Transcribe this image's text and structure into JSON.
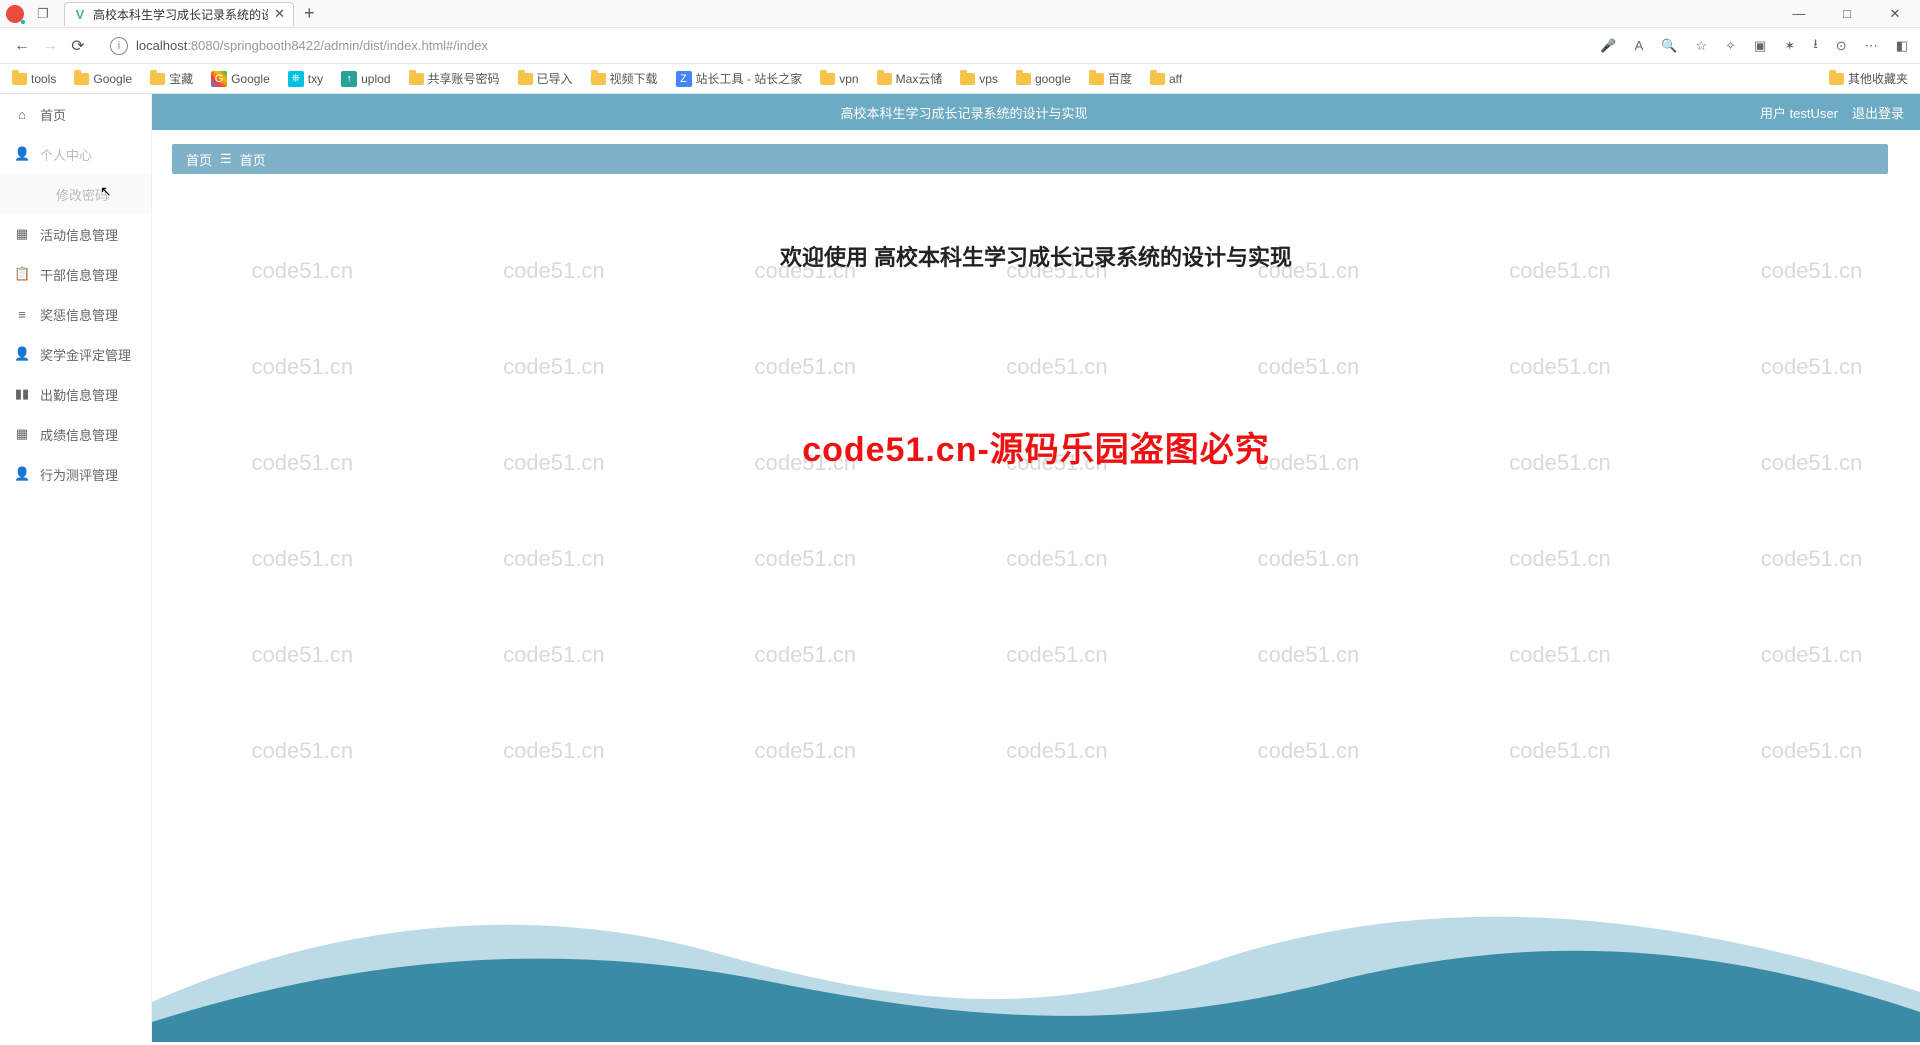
{
  "browser": {
    "tab_title": "高校本科生学习成长记录系统的设…",
    "url_host": "localhost",
    "url_port": ":8080",
    "url_path": "/springbooth8422/admin/dist/index.html#/index",
    "new_tab_plus": "+",
    "win_min": "—",
    "win_max": "□",
    "win_close": "✕",
    "back": "←",
    "fwd": "→",
    "reload": "⟳"
  },
  "bookmarks": [
    {
      "label": "tools",
      "kind": "folder"
    },
    {
      "label": "Google",
      "kind": "folder"
    },
    {
      "label": "宝藏",
      "kind": "folder"
    },
    {
      "label": "Google",
      "kind": "multi"
    },
    {
      "label": "txy",
      "kind": "cyan"
    },
    {
      "label": "uplod",
      "kind": "teal"
    },
    {
      "label": "共享账号密码",
      "kind": "folder"
    },
    {
      "label": "已导入",
      "kind": "folder"
    },
    {
      "label": "视频下载",
      "kind": "folder"
    },
    {
      "label": "站长工具 - 站长之家",
      "kind": "blue"
    },
    {
      "label": "vpn",
      "kind": "folder"
    },
    {
      "label": "Max云储",
      "kind": "folder"
    },
    {
      "label": "vps",
      "kind": "folder"
    },
    {
      "label": "google",
      "kind": "folder"
    },
    {
      "label": "百度",
      "kind": "folder"
    },
    {
      "label": "aff",
      "kind": "folder"
    }
  ],
  "bookmarks_right": "其他收藏夹",
  "sidebar": {
    "items": [
      {
        "icon": "⌂",
        "label": "首页"
      },
      {
        "icon": "👤",
        "label": "个人中心",
        "expanded": true
      },
      {
        "icon": "",
        "label": "修改密码",
        "sub": true,
        "hover": true
      },
      {
        "icon": "▦",
        "label": "活动信息管理"
      },
      {
        "icon": "📋",
        "label": "干部信息管理"
      },
      {
        "icon": "≡",
        "label": "奖惩信息管理"
      },
      {
        "icon": "👤",
        "label": "奖学金评定管理"
      },
      {
        "icon": "▮▮",
        "label": "出勤信息管理"
      },
      {
        "icon": "▦",
        "label": "成绩信息管理"
      },
      {
        "icon": "👤",
        "label": "行为测评管理"
      }
    ]
  },
  "topbar": {
    "title": "高校本科生学习成长记录系统的设计与实现",
    "user_label": "用户 testUser",
    "logout": "退出登录"
  },
  "crumb": {
    "root": "首页",
    "sep": "☰",
    "current": "首页"
  },
  "content": {
    "welcome": "欢迎使用 高校本科生学习成长记录系统的设计与实现",
    "redline": "code51.cn-源码乐园盗图必究"
  },
  "watermark_text": "code51.cn"
}
